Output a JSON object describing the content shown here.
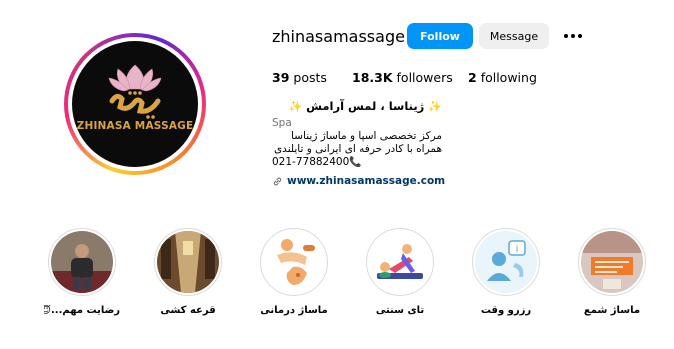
{
  "profile": {
    "username": "zhinasamassage",
    "avatar_brand_text": "ZHINASA MASSAGE",
    "avatar_logo_text": "ژینا",
    "follow_label": "Follow",
    "message_label": "Message",
    "more_icon": "more-horizontal-icon"
  },
  "stats": {
    "posts_count": "39",
    "posts_label": "posts",
    "followers_count": "18.3K",
    "followers_label": "followers",
    "following_count": "2",
    "following_label": "following"
  },
  "bio": {
    "name": "ژیناسا ، لمس آرامش",
    "sparkle": "✨",
    "category": "Spa",
    "line1": "مرکز تخصصی اسپا و ماساژ ژیناسا",
    "line2": "همراه با کادر حرفه ای ایرانی و تایلندی",
    "phone": "021-77882400",
    "phone_icon": "📞",
    "website": "www.zhinasamassage.com",
    "link_icon": "link-icon"
  },
  "highlights": [
    {
      "label": "رضایت مهم...😇"
    },
    {
      "label": "قرعه کشی"
    },
    {
      "label": "ماساژ درمانی"
    },
    {
      "label": "تای سنتی"
    },
    {
      "label": "رزرو وقت"
    },
    {
      "label": "ماساژ شمع"
    }
  ],
  "colors": {
    "follow_button": "#0095f6",
    "message_button": "#efefef",
    "link": "#00376b",
    "category": "#737373",
    "brand_gold": "#d9a441"
  }
}
